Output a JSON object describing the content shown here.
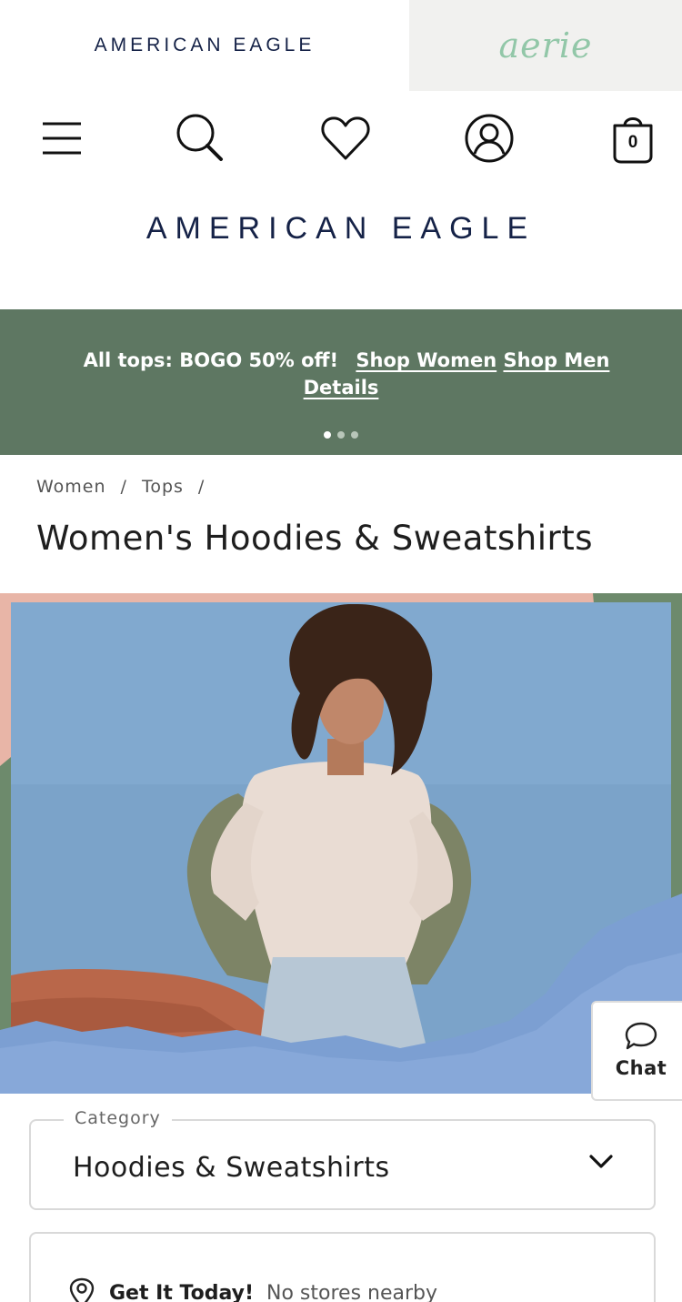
{
  "brand_tabs": {
    "american_eagle": "AMERICAN EAGLE",
    "aerie": "aerie"
  },
  "header": {
    "logo": "AMERICAN EAGLE",
    "cart_count": "0",
    "icons": [
      "menu-icon",
      "search-icon",
      "heart-icon",
      "account-icon",
      "bag-icon"
    ]
  },
  "promo": {
    "text": "All tops: BOGO 50% off!",
    "shop_women": "Shop Women",
    "shop_men": "Shop Men",
    "details": "Details",
    "slide_count": 3,
    "active_slide": 1
  },
  "breadcrumb": {
    "items": [
      "Women",
      "Tops"
    ],
    "separator": "/"
  },
  "page": {
    "title": "Women's Hoodies & Sweatshirts"
  },
  "chat": {
    "label": "Chat"
  },
  "category": {
    "legend": "Category",
    "selected": "Hoodies & Sweatshirts"
  },
  "pickup": {
    "title": "Get It Today!",
    "status": "No stores nearby"
  },
  "colors": {
    "brand_navy": "#152247",
    "aerie_green": "#92c7a8",
    "promo_green": "#5e7762"
  }
}
